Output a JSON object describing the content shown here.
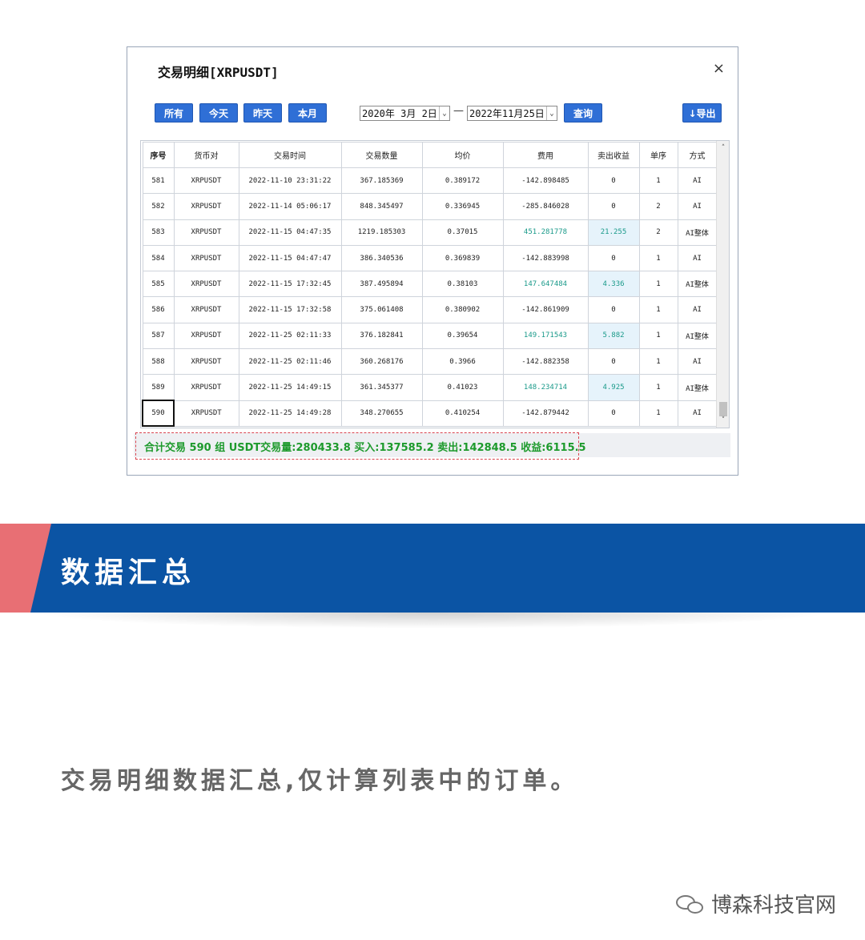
{
  "dialog": {
    "title": "交易明细[XRPUSDT]",
    "close_label": "×",
    "buttons": {
      "all": "所有",
      "today": "今天",
      "yesterday": "昨天",
      "this_month": "本月",
      "query": "查询",
      "export": "↓导出"
    },
    "date_from": "2020年 3月 2日",
    "date_to": "2022年11月25日",
    "date_separator": "—",
    "dropdown_icon": "⌄"
  },
  "table": {
    "columns": [
      "序号",
      "货币对",
      "交易时间",
      "交易数量",
      "均价",
      "费用",
      "卖出收益",
      "单序",
      "方式"
    ],
    "rows": [
      [
        "581",
        "XRPUSDT",
        "2022-11-10 23:31:22",
        "367.185369",
        "0.389172",
        "-142.898485",
        "0",
        "1",
        "AI"
      ],
      [
        "582",
        "XRPUSDT",
        "2022-11-14 05:06:17",
        "848.345497",
        "0.336945",
        "-285.846028",
        "0",
        "2",
        "AI"
      ],
      [
        "583",
        "XRPUSDT",
        "2022-11-15 04:47:35",
        "1219.185303",
        "0.37015",
        "451.281778",
        "21.255",
        "2",
        "AI整体"
      ],
      [
        "584",
        "XRPUSDT",
        "2022-11-15 04:47:47",
        "386.340536",
        "0.369839",
        "-142.883998",
        "0",
        "1",
        "AI"
      ],
      [
        "585",
        "XRPUSDT",
        "2022-11-15 17:32:45",
        "387.495894",
        "0.38103",
        "147.647484",
        "4.336",
        "1",
        "AI整体"
      ],
      [
        "586",
        "XRPUSDT",
        "2022-11-15 17:32:58",
        "375.061408",
        "0.380902",
        "-142.861909",
        "0",
        "1",
        "AI"
      ],
      [
        "587",
        "XRPUSDT",
        "2022-11-25 02:11:33",
        "376.182841",
        "0.39654",
        "149.171543",
        "5.882",
        "1",
        "AI整体"
      ],
      [
        "588",
        "XRPUSDT",
        "2022-11-25 02:11:46",
        "360.268176",
        "0.3966",
        "-142.882358",
        "0",
        "1",
        "AI"
      ],
      [
        "589",
        "XRPUSDT",
        "2022-11-25 14:49:15",
        "361.345377",
        "0.41023",
        "148.234714",
        "4.925",
        "1",
        "AI整体"
      ],
      [
        "590",
        "XRPUSDT",
        "2022-11-25 14:49:28",
        "348.270655",
        "0.410254",
        "-142.879442",
        "0",
        "1",
        "AI"
      ]
    ],
    "scroll_up": "˄",
    "scroll_down": "˅"
  },
  "summary": "合计交易 590 组   USDT交易量:280433.8  买入:137585.2  卖出:142848.5  收益:6115.5",
  "banner": {
    "title": "数据汇总"
  },
  "description": "交易明细数据汇总,仅计算列表中的订单。",
  "watermark": {
    "text": "博森科技官网"
  }
}
